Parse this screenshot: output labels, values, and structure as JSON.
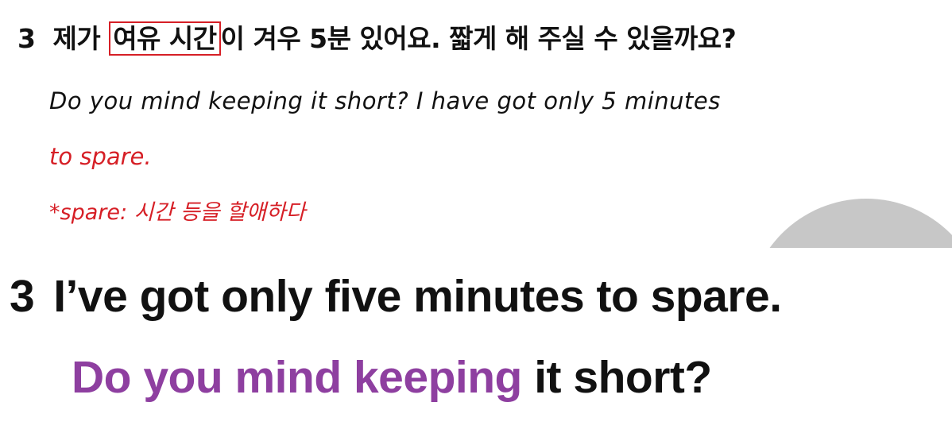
{
  "top": {
    "number": "3",
    "korean_before": "제가 ",
    "korean_boxed": "여유 시간",
    "korean_after": "이 겨우 5분 있어요. 짧게 해 주실 수 있을까요?",
    "handwritten_line1": "Do you mind keeping it short? I have got only 5 minutes",
    "handwritten_line2": "to spare.",
    "handwritten_note": "*spare: 시간 등을 할애하다"
  },
  "bottom": {
    "number": "3",
    "sentence": "I’ve got only five minutes to spare.",
    "question_highlight": "Do you mind keeping",
    "question_rest": " it short?"
  },
  "colors": {
    "red": "#d61f26",
    "purple": "#8e3fa0",
    "text": "#111111"
  }
}
